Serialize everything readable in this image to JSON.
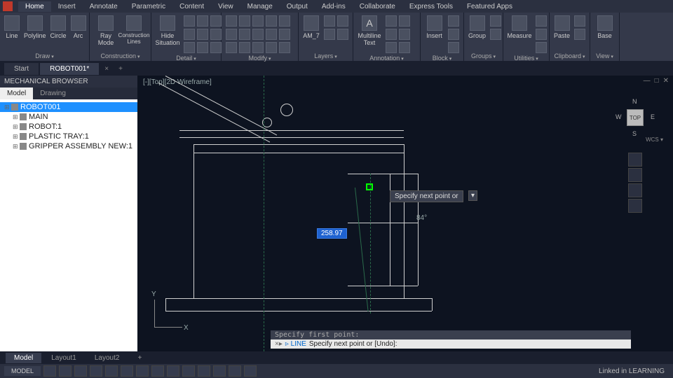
{
  "menu": {
    "items": [
      "Home",
      "Insert",
      "Annotate",
      "Parametric",
      "Content",
      "View",
      "Manage",
      "Output",
      "Add-ins",
      "Collaborate",
      "Express Tools",
      "Featured Apps"
    ],
    "active_index": 0
  },
  "ribbon": {
    "panels": [
      {
        "title": "Draw",
        "big": [
          {
            "label": "Line"
          },
          {
            "label": "Polyline"
          },
          {
            "label": "Circle"
          },
          {
            "label": "Arc"
          }
        ],
        "smallCount": 0
      },
      {
        "title": "Construction",
        "big": [
          {
            "label": "Ray\nMode"
          },
          {
            "label": "Construction\nLines"
          }
        ],
        "smallCount": 0
      },
      {
        "title": "Detail",
        "big": [
          {
            "label": "Hide\nSituation"
          }
        ],
        "smallCount": 9
      },
      {
        "title": "Modify",
        "big": [],
        "smallCount": 15
      },
      {
        "title": "Layers",
        "big": [
          {
            "label": "AM_7"
          }
        ],
        "smallCount": 4
      },
      {
        "title": "Annotation",
        "big": [
          {
            "label": "Multiline\nText"
          }
        ],
        "smallCount": 6
      },
      {
        "title": "Block",
        "big": [
          {
            "label": "Insert"
          }
        ],
        "smallCount": 3
      },
      {
        "title": "Groups",
        "big": [
          {
            "label": "Group"
          }
        ],
        "smallCount": 2
      },
      {
        "title": "Utilities",
        "big": [
          {
            "label": "Measure"
          }
        ],
        "smallCount": 3
      },
      {
        "title": "Clipboard",
        "big": [
          {
            "label": "Paste"
          }
        ],
        "smallCount": 2
      },
      {
        "title": "View",
        "big": [
          {
            "label": "Base"
          }
        ],
        "smallCount": 0
      }
    ]
  },
  "doctabs": {
    "items": [
      {
        "label": "Start",
        "active": false
      },
      {
        "label": "ROBOT001*",
        "active": true
      }
    ],
    "close": "×",
    "plus": "+"
  },
  "browser": {
    "title": "MECHANICAL BROWSER",
    "tabs": [
      {
        "label": "Model",
        "active": true
      },
      {
        "label": "Drawing",
        "active": false
      }
    ],
    "tree": [
      {
        "label": "ROBOT001",
        "sel": true,
        "root": true
      },
      {
        "label": "MAIN"
      },
      {
        "label": "ROBOT:1"
      },
      {
        "label": "PLASTIC TRAY:1"
      },
      {
        "label": "GRIPPER ASSEMBLY NEW:1"
      }
    ]
  },
  "canvas": {
    "view_label": "[-][Top][2D Wireframe]",
    "dim_value": "258.97",
    "tooltip": "Specify next point or",
    "angle": "84°",
    "ucs": {
      "x": "X",
      "y": "Y"
    },
    "viewcube": {
      "face": "TOP",
      "n": "N",
      "s": "S",
      "e": "E",
      "w": "W",
      "wcs": "WCS ▾"
    },
    "win_controls": [
      "—",
      "□",
      "✕"
    ]
  },
  "command": {
    "history": "Specify first point:",
    "prompt_prefix": "▹ LINE",
    "prompt": "Specify next point or [Undo]:"
  },
  "layouttabs": {
    "items": [
      {
        "label": "Model",
        "active": true
      },
      {
        "label": "Layout1"
      },
      {
        "label": "Layout2"
      }
    ],
    "plus": "+"
  },
  "status": {
    "model": "MODEL",
    "brand": "Linked in LEARNING",
    "btnCount": 14
  }
}
